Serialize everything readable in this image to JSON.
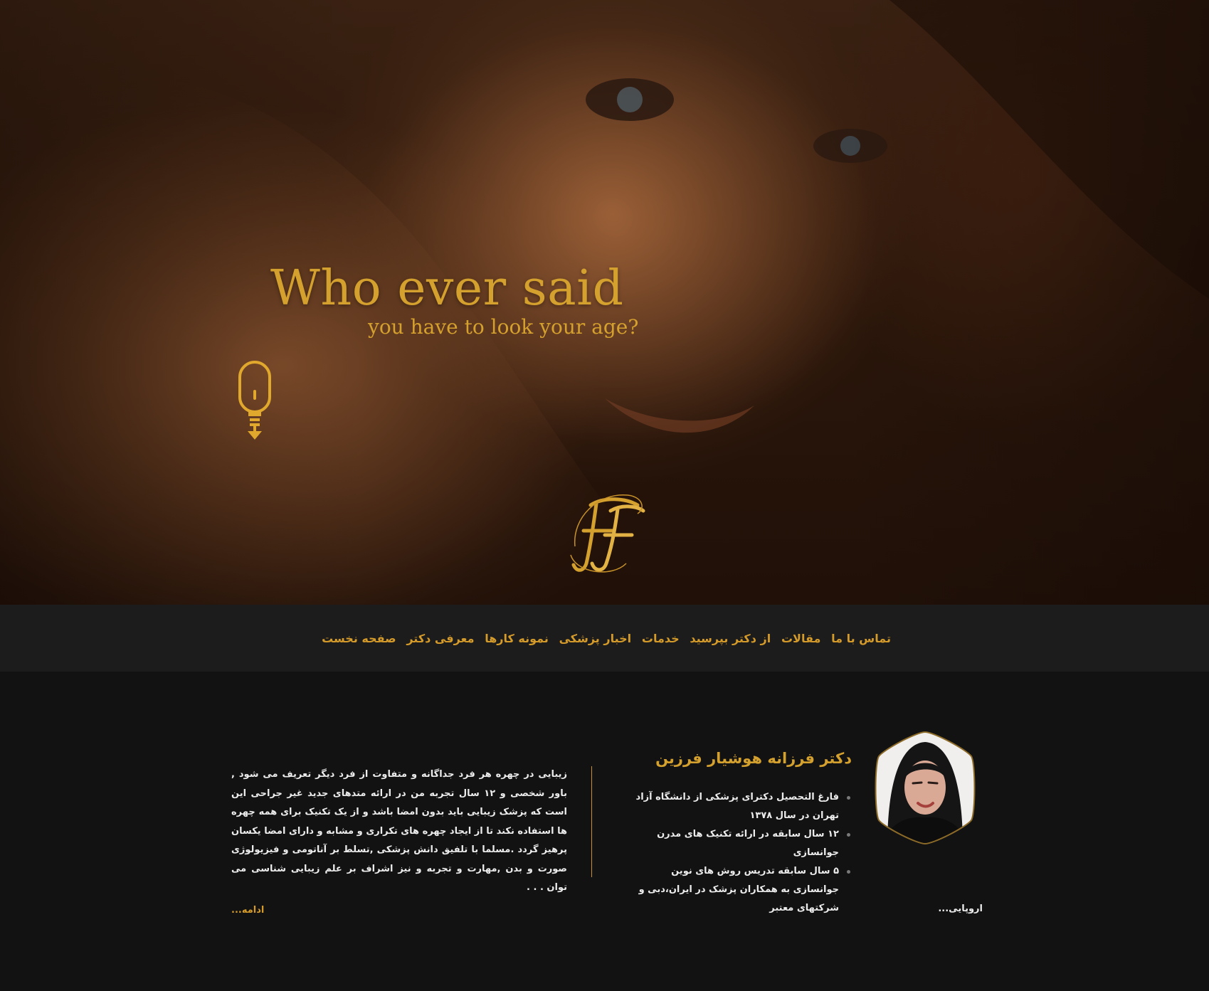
{
  "hero": {
    "headline": "Who ever said",
    "subline": "you have to look your age?",
    "logo_icon": "ff-monogram-logo",
    "scroll_icon": "scroll-down-mouse-icon"
  },
  "nav": {
    "items": [
      {
        "label": "صفحه نخست"
      },
      {
        "label": "معرفی دکتر"
      },
      {
        "label": "نمونه کارها"
      },
      {
        "label": "اخبار پزشکی"
      },
      {
        "label": "خدمات"
      },
      {
        "label": "از دکتر بپرسید"
      },
      {
        "label": "مقالات"
      },
      {
        "label": "تماس با ما"
      }
    ]
  },
  "doctor": {
    "name": "دکتر فرزانه هوشیار فرزین",
    "bio": [
      "فارغ التحصیل دکترای پزشکی از دانشگاه آزاد تهران در سال ۱۳۷۸",
      "۱۲ سال سابقه در ارائه تکنیک های مدرن جوانسازی",
      "۵ سال سابقه تدریس روش های نوین جوانسازی به همکاران پزشک در ایران،دبی و شرکتهای معتبر"
    ],
    "more": "اروپایی..."
  },
  "intro": {
    "text": "زیبایی در چهره هر فرد جداگانه و متفاوت از فرد دیگر تعریف می شود , باور شخصی و ۱۲ سال تجربه من در ارائه متدهای جدید غیر جراحی این است که پزشک زیبایی باید بدون امضا باشد و از یک تکنیک برای همه چهره ها استفاده نکند تا از ایجاد چهره های تکراری و مشابه و دارای امضا یکسان پرهیز گردد .مسلما با تلفیق دانش پزشکی ,تسلط بر آناتومی و فیزیولوژی صورت و بدن ,مهارت و تجربه و نیز اشراف بر علم زیبایی شناسی می توان . . .",
    "read_more": "ادامه..."
  },
  "colors": {
    "accent": "#d4a02e",
    "nav_bg": "#1c1c1c",
    "body_bg": "#121212"
  }
}
